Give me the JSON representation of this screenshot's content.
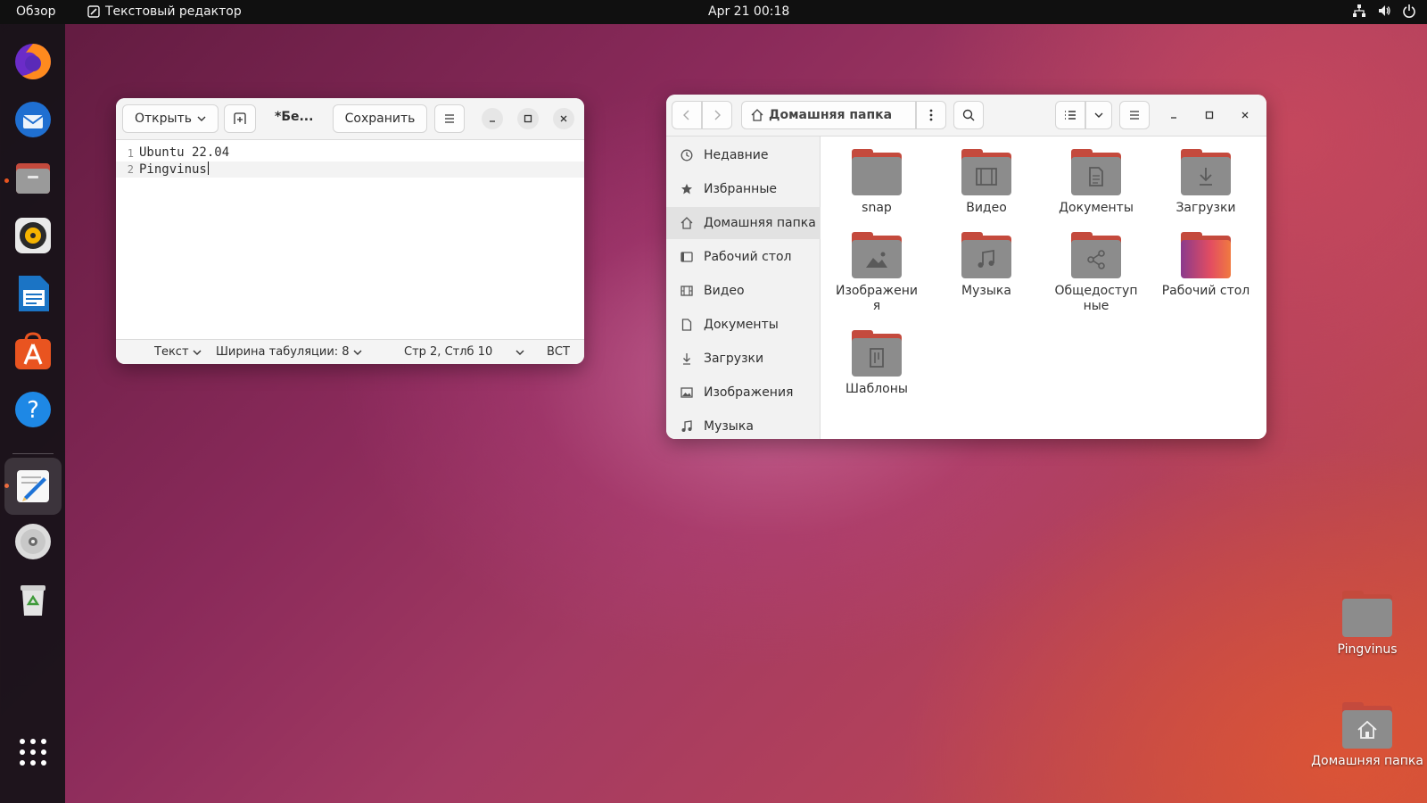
{
  "topbar": {
    "activities": "Обзор",
    "app_name": "Текстовый редактор",
    "clock": "Apr 21  00:18",
    "tray_icons": [
      "network-icon",
      "volume-icon",
      "power-icon"
    ]
  },
  "dock": {
    "apps": [
      "firefox",
      "thunderbird",
      "files",
      "rhythmbox",
      "writer",
      "software",
      "help",
      "text-editor",
      "disc",
      "trash"
    ],
    "show_apps_icon": "grid-icon"
  },
  "editor": {
    "open_label": "Открыть",
    "title": "*Бе...",
    "save_label": "Сохранить",
    "lines": [
      {
        "num": "1",
        "text": "Ubuntu 22.04"
      },
      {
        "num": "2",
        "text": "Pingvinus"
      }
    ],
    "status": {
      "syntax": "Текст",
      "tab_width": "Ширина табуляции: 8",
      "position": "Стр 2, Стлб 10",
      "mode": "ВСТ"
    }
  },
  "files": {
    "path": "Домашняя папка",
    "sidebar": [
      {
        "label": "Недавние",
        "icon": "clock-icon"
      },
      {
        "label": "Избранные",
        "icon": "star-icon"
      },
      {
        "label": "Домашняя папка",
        "icon": "home-icon"
      },
      {
        "label": "Рабочий стол",
        "icon": "desktop-icon"
      },
      {
        "label": "Видео",
        "icon": "video-icon"
      },
      {
        "label": "Документы",
        "icon": "document-icon"
      },
      {
        "label": "Загрузки",
        "icon": "download-icon"
      },
      {
        "label": "Изображения",
        "icon": "image-icon"
      },
      {
        "label": "Музыка",
        "icon": "music-icon"
      }
    ],
    "folders": [
      {
        "label": "snap",
        "icon": "folder-icon"
      },
      {
        "label": "Видео",
        "icon": "video-icon"
      },
      {
        "label": "Документы",
        "icon": "document-icon"
      },
      {
        "label": "Загрузки",
        "icon": "download-icon"
      },
      {
        "label": "Изображения",
        "icon": "image-icon"
      },
      {
        "label": "Музыка",
        "icon": "music-icon"
      },
      {
        "label": "Общедоступные",
        "icon": "share-icon"
      },
      {
        "label": "Рабочий стол",
        "icon": "desktop-icon"
      },
      {
        "label": "Шаблоны",
        "icon": "template-icon"
      }
    ]
  },
  "desktop": {
    "icons": [
      {
        "label": "Pingvinus"
      },
      {
        "label": "Домашняя папка"
      }
    ]
  },
  "colors": {
    "accent": "#e95420",
    "folder_tab": "#c44a3d",
    "folder_body": "#8c8c8c"
  }
}
